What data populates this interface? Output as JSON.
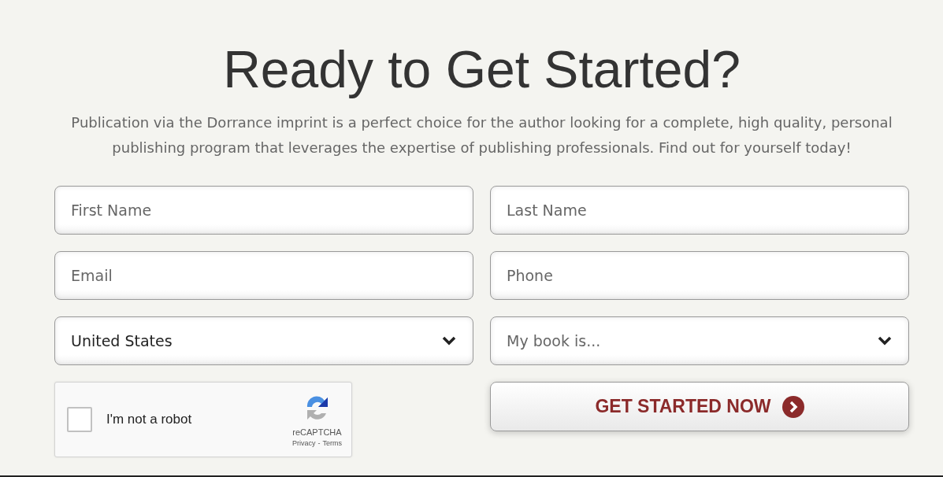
{
  "heading": "Ready to Get Started?",
  "intro": "Publication via the Dorrance imprint is a perfect choice for the author looking for a complete, high quality, personal publishing program that leverages the expertise of publishing professionals. Find out for yourself today!",
  "fields": [
    {
      "kind": "text",
      "placeholder": "First Name"
    },
    {
      "kind": "text",
      "placeholder": "Last Name"
    },
    {
      "kind": "text",
      "placeholder": "Email"
    },
    {
      "kind": "text",
      "placeholder": "Phone"
    },
    {
      "kind": "select",
      "value": "United States"
    },
    {
      "kind": "select",
      "placeholder": "My book is..."
    }
  ],
  "captcha": {
    "label": "I'm not a robot",
    "checked": false,
    "brand": "reCAPTCHA",
    "privacy": "Privacy",
    "separator": "-",
    "terms": "Terms"
  },
  "submit": {
    "label": "GET STARTED NOW"
  }
}
